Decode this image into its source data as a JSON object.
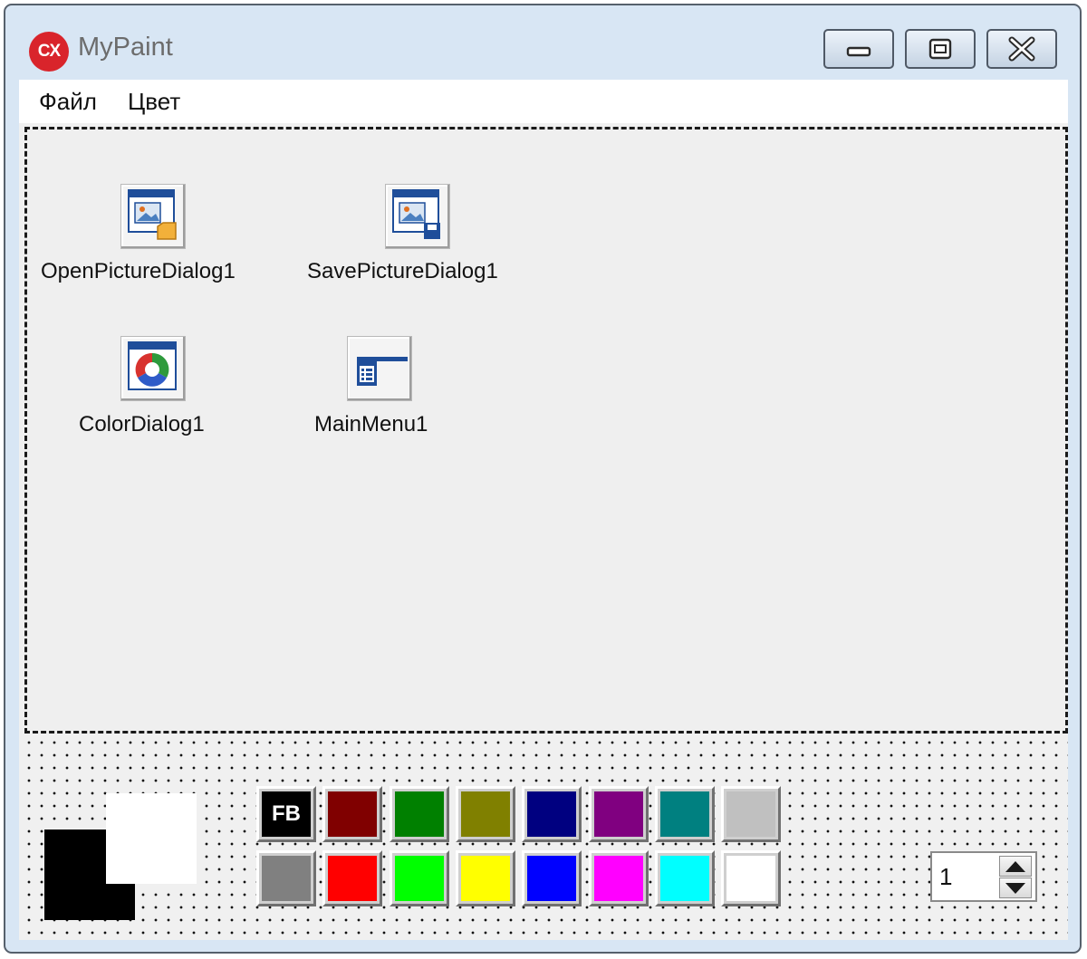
{
  "window": {
    "title": "MyPaint",
    "app_icon_text": "CX"
  },
  "menu": {
    "items": [
      {
        "label": "Файл"
      },
      {
        "label": "Цвет"
      }
    ]
  },
  "components": [
    {
      "label": "OpenPictureDialog1",
      "icon": "open-picture-dialog-icon"
    },
    {
      "label": "SavePictureDialog1",
      "icon": "save-picture-dialog-icon"
    },
    {
      "label": "ColorDialog1",
      "icon": "color-dialog-icon"
    },
    {
      "label": "MainMenu1",
      "icon": "main-menu-icon"
    }
  ],
  "color_indicator": {
    "foreground": "#000000",
    "background": "#ffffff"
  },
  "palette": {
    "fb_label": "FB",
    "colors": [
      "#000000",
      "#800000",
      "#008000",
      "#808000",
      "#000080",
      "#800080",
      "#008080",
      "#c0c0c0",
      "#808080",
      "#ff0000",
      "#00ff00",
      "#ffff00",
      "#0000ff",
      "#ff00ff",
      "#00ffff",
      "#ffffff"
    ]
  },
  "pen_width": {
    "value": "1"
  }
}
